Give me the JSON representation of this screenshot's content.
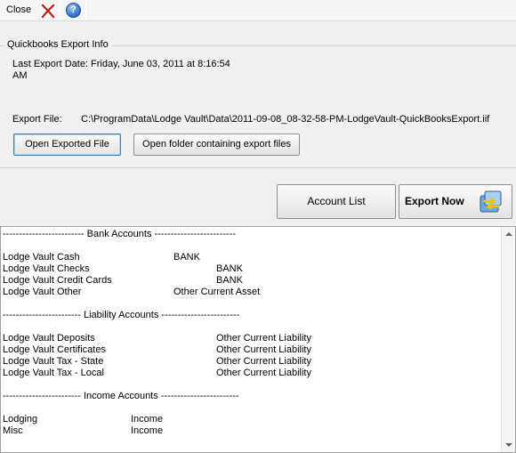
{
  "toolbar": {
    "close_label": "Close",
    "icons": [
      "close-x-icon",
      "help-icon"
    ],
    "help_glyph": "?"
  },
  "export_info": {
    "group_title": "Quickbooks Export Info",
    "last_export_line1": "Last Export Date: Friday, June 03, 2011 at 8:16:54",
    "last_export_line2": "AM",
    "export_file_label": "Export File:",
    "export_file_path": "C:\\ProgramData\\Lodge Vault\\Data\\2011-09-08_08-32-58-PM-LodgeVault-QuickBooksExport.iif",
    "open_exported_label": "Open Exported File",
    "open_folder_label": "Open folder containing export files"
  },
  "actions": {
    "account_list_label": "Account List",
    "export_now_label": "Export Now"
  },
  "accounts": {
    "bank_header": "------------------------- Bank Accounts -------------------------",
    "bank": [
      {
        "name": "Lodge Vault Cash",
        "type": "BANK"
      },
      {
        "name": "Lodge Vault Checks",
        "type": "BANK"
      },
      {
        "name": "Lodge Vault Credit Cards",
        "type": "BANK"
      },
      {
        "name": "Lodge Vault Other",
        "type": "Other Current Asset"
      }
    ],
    "liability_header": "------------------------ Liability Accounts ------------------------",
    "liability": [
      {
        "name": "Lodge Vault Deposits",
        "type": "Other Current Liability"
      },
      {
        "name": "Lodge Vault Certificates",
        "type": "Other Current Liability"
      },
      {
        "name": "Lodge Vault Tax - State",
        "type": "Other Current Liability"
      },
      {
        "name": "Lodge Vault Tax - Local",
        "type": "Other Current Liability"
      }
    ],
    "income_header": "------------------------ Income Accounts ------------------------",
    "income": [
      {
        "name": "Lodging",
        "type": "Income"
      },
      {
        "name": "Misc",
        "type": "Income"
      }
    ]
  },
  "colors": {
    "background": "#f0f0f0",
    "close_x": "#d42020",
    "help_blue": "#2f6fc4",
    "focus_border": "#3c7fb1"
  }
}
